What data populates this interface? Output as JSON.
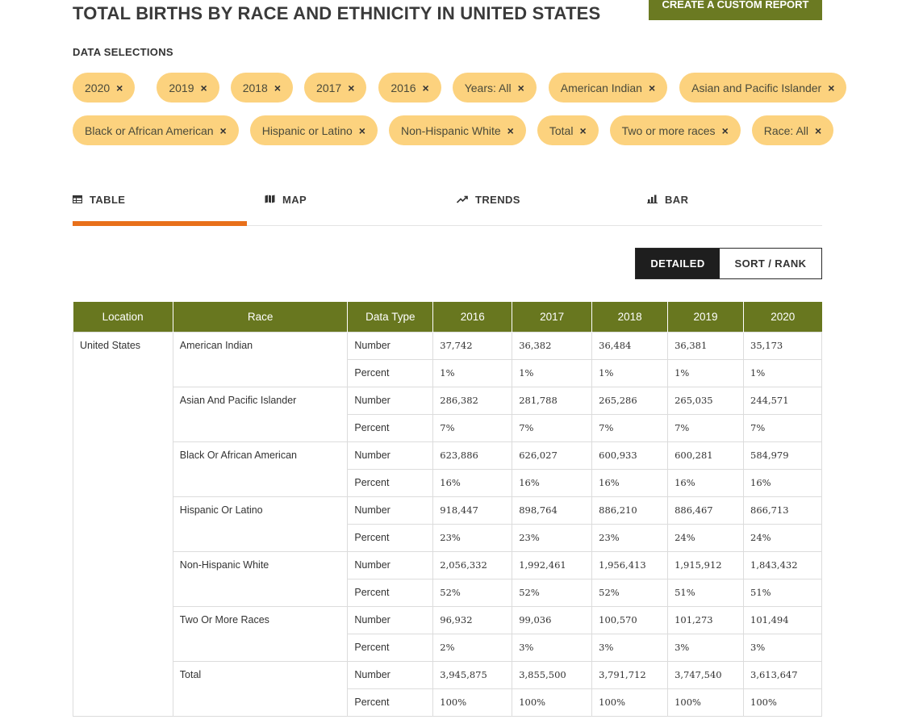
{
  "header": {
    "title": "TOTAL BIRTHS BY RACE AND ETHNICITY IN UNITED STATES",
    "custom_report_label": "CREATE A CUSTOM REPORT"
  },
  "selections": {
    "label": "DATA SELECTIONS",
    "remove_glyph": "×",
    "row1": [
      "2020",
      "2019",
      "2018",
      "2017",
      "2016",
      "Years: All",
      "American Indian",
      "Asian and Pacific Islander"
    ],
    "row2": [
      "Black or African American",
      "Hispanic or Latino",
      "Non-Hispanic White",
      "Total",
      "Two or more races",
      "Race: All"
    ]
  },
  "tabs": [
    {
      "label": "TABLE",
      "icon": "table-icon",
      "active": true
    },
    {
      "label": "MAP",
      "icon": "map-icon",
      "active": false
    },
    {
      "label": "TRENDS",
      "icon": "trend-icon",
      "active": false
    },
    {
      "label": "BAR",
      "icon": "bar-chart-icon",
      "active": false
    }
  ],
  "view_toggle": {
    "detailed": "DETAILED",
    "sort_rank": "SORT / RANK"
  },
  "table": {
    "columns": [
      "Location",
      "Race",
      "Data Type",
      "2016",
      "2017",
      "2018",
      "2019",
      "2020"
    ],
    "location": "United States",
    "groups": [
      {
        "race": "American Indian",
        "rows": [
          {
            "type": "Number",
            "values": [
              "37,742",
              "36,382",
              "36,484",
              "36,381",
              "35,173"
            ]
          },
          {
            "type": "Percent",
            "values": [
              "1%",
              "1%",
              "1%",
              "1%",
              "1%"
            ]
          }
        ]
      },
      {
        "race": "Asian And Pacific Islander",
        "rows": [
          {
            "type": "Number",
            "values": [
              "286,382",
              "281,788",
              "265,286",
              "265,035",
              "244,571"
            ]
          },
          {
            "type": "Percent",
            "values": [
              "7%",
              "7%",
              "7%",
              "7%",
              "7%"
            ]
          }
        ]
      },
      {
        "race": "Black Or African American",
        "rows": [
          {
            "type": "Number",
            "values": [
              "623,886",
              "626,027",
              "600,933",
              "600,281",
              "584,979"
            ]
          },
          {
            "type": "Percent",
            "values": [
              "16%",
              "16%",
              "16%",
              "16%",
              "16%"
            ]
          }
        ]
      },
      {
        "race": "Hispanic Or Latino",
        "rows": [
          {
            "type": "Number",
            "values": [
              "918,447",
              "898,764",
              "886,210",
              "886,467",
              "866,713"
            ]
          },
          {
            "type": "Percent",
            "values": [
              "23%",
              "23%",
              "23%",
              "24%",
              "24%"
            ]
          }
        ]
      },
      {
        "race": "Non-Hispanic White",
        "rows": [
          {
            "type": "Number",
            "values": [
              "2,056,332",
              "1,992,461",
              "1,956,413",
              "1,915,912",
              "1,843,432"
            ]
          },
          {
            "type": "Percent",
            "values": [
              "52%",
              "52%",
              "52%",
              "51%",
              "51%"
            ]
          }
        ]
      },
      {
        "race": "Two Or More Races",
        "rows": [
          {
            "type": "Number",
            "values": [
              "96,932",
              "99,036",
              "100,570",
              "101,273",
              "101,494"
            ]
          },
          {
            "type": "Percent",
            "values": [
              "2%",
              "3%",
              "3%",
              "3%",
              "3%"
            ]
          }
        ]
      },
      {
        "race": "Total",
        "rows": [
          {
            "type": "Number",
            "values": [
              "3,945,875",
              "3,855,500",
              "3,791,712",
              "3,747,540",
              "3,613,647"
            ]
          },
          {
            "type": "Percent",
            "values": [
              "100%",
              "100%",
              "100%",
              "100%",
              "100%"
            ]
          }
        ]
      }
    ]
  },
  "colors": {
    "primary_green": "#68771f",
    "chip": "#fcd27e",
    "accent_orange": "#e8701a"
  }
}
